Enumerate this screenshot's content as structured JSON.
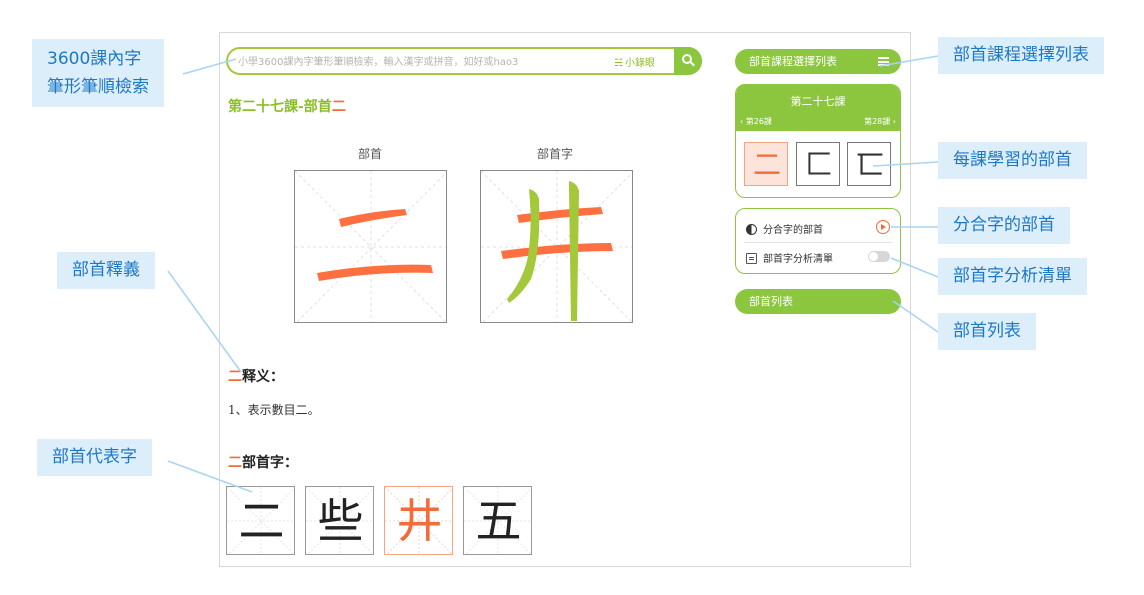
{
  "search": {
    "placeholder": "小學3600課內字筆形筆順檢索，輸入漢字或拼音，如好或hao3",
    "mini_dict_icon": "☵",
    "mini_dict_label": "小錄眼"
  },
  "lesson": {
    "title_main": "第二十七課-部首",
    "title_radical": "二"
  },
  "stroke_panel": {
    "radical_label": "部首",
    "radical_char": "二",
    "example_label": "部首字",
    "example_char": "井"
  },
  "meaning": {
    "radical": "二",
    "heading": "释义：",
    "text": "1、表示數目二。"
  },
  "examples": {
    "radical": "二",
    "heading": "部首字：",
    "chars": [
      "二",
      "些",
      "井",
      "五"
    ],
    "active_index": 2
  },
  "right_panel": {
    "course_list_label": "部首課程選擇列表",
    "lesson_card": {
      "title": "第二十七課",
      "prev": "‹ 第26課",
      "next": "第28課 ›",
      "radicals": [
        "二",
        "匚",
        "匸"
      ],
      "active_index": 0
    },
    "options": {
      "split_label": "分合字的部首",
      "analysis_label": "部首字分析清單"
    },
    "radical_list_label": "部首列表"
  },
  "callouts": {
    "search": "3600課內字\n筆形筆順檢索",
    "meaning": "部首釋義",
    "examples": "部首代表字",
    "course_list": "部首課程選擇列表",
    "lesson_radicals": "每課學習的部首",
    "split": "分合字的部首",
    "analysis": "部首字分析清單",
    "radical_list": "部首列表"
  },
  "colors": {
    "accent_green": "#8cc63f",
    "accent_orange": "#f26b3a",
    "callout_bg": "#dbeefa",
    "callout_text": "#1e78c8"
  }
}
